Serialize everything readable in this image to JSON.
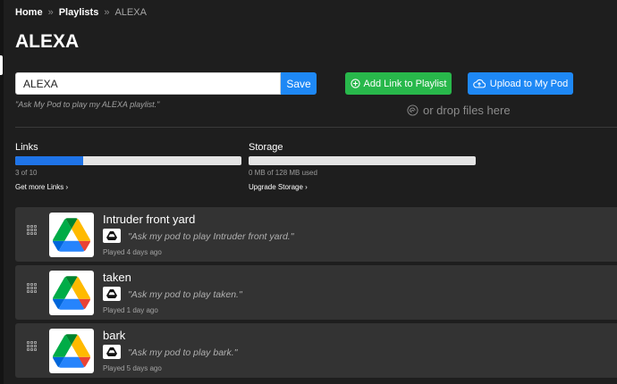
{
  "breadcrumb": {
    "home": "Home",
    "separator": "»",
    "playlists": "Playlists",
    "current": "ALEXA"
  },
  "page_title": "ALEXA",
  "name_field": {
    "value": "ALEXA",
    "save_label": "Save"
  },
  "hint": "\"Ask My Pod to play my ALEXA playlist.\"",
  "actions": {
    "add_link_label": "Add Link to Playlist",
    "upload_label": "Upload to My Pod",
    "drop_label": "or drop files here"
  },
  "links_meter": {
    "label": "Links",
    "used": 3,
    "total": 10,
    "fraction": 0.3,
    "usage_text": "3 of 10",
    "more_label": "Get more Links ›"
  },
  "storage_meter": {
    "label": "Storage",
    "fraction": 0.0,
    "usage_text": "0 MB of 128 MB used",
    "more_label": "Upgrade Storage ›"
  },
  "colors": {
    "accent_blue": "#1e88f5",
    "accent_green": "#28b84b",
    "background": "#1e1e1e",
    "card": "#333333"
  },
  "playlist": [
    {
      "title": "Intruder front yard",
      "phrase": "\"Ask my pod to play Intruder front yard.\"",
      "played": "Played 4 days ago",
      "icon": "google-drive-icon"
    },
    {
      "title": "taken",
      "phrase": "\"Ask my pod to play taken.\"",
      "played": "Played 1 day ago",
      "icon": "google-drive-icon"
    },
    {
      "title": "bark",
      "phrase": "\"Ask my pod to play bark.\"",
      "played": "Played 5 days ago",
      "icon": "google-drive-icon"
    }
  ]
}
